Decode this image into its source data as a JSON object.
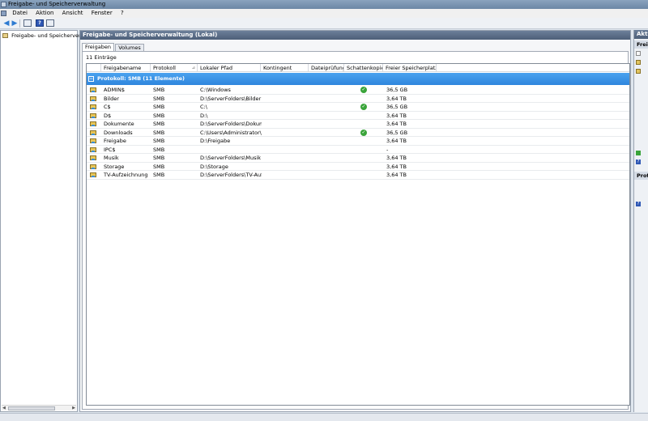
{
  "window": {
    "title": "Freigabe- und Speicherverwaltung"
  },
  "menu": {
    "items": [
      {
        "label": "Datei"
      },
      {
        "label": "Aktion"
      },
      {
        "label": "Ansicht"
      },
      {
        "label": "Fenster"
      },
      {
        "label": "?"
      }
    ]
  },
  "toolbar": {
    "back_icon": "back-arrow-icon",
    "forward_icon": "forward-arrow-icon",
    "help_glyph": "?"
  },
  "tree": {
    "root_label": "Freigabe- und Speicherverwalt"
  },
  "center": {
    "header": "Freigabe- und Speicherverwaltung (Lokal)",
    "tabs": [
      {
        "label": "Freigaben",
        "active": true
      },
      {
        "label": "Volumes",
        "active": false
      }
    ],
    "entry_count": "11 Einträge",
    "columns": [
      {
        "label": "Freigabename"
      },
      {
        "label": "Protokoll"
      },
      {
        "label": "Lokaler Pfad"
      },
      {
        "label": "Kontingent"
      },
      {
        "label": "Dateiprüfung"
      },
      {
        "label": "Schattenkopien"
      },
      {
        "label": "Freier Speicherplatz"
      }
    ],
    "group": {
      "toggle": "⊟",
      "label": "Protokoll: SMB (11 Elemente)"
    },
    "rows": [
      {
        "name": "ADMIN$",
        "protocol": "SMB",
        "path": "C:\\Windows",
        "shadow": true,
        "free": "36,5 GB"
      },
      {
        "name": "Bilder",
        "protocol": "SMB",
        "path": "D:\\ServerFolders\\Bilder",
        "shadow": false,
        "free": "3,64 TB"
      },
      {
        "name": "C$",
        "protocol": "SMB",
        "path": "C:\\",
        "shadow": true,
        "free": "36,5 GB"
      },
      {
        "name": "D$",
        "protocol": "SMB",
        "path": "D:\\",
        "shadow": false,
        "free": "3,64 TB"
      },
      {
        "name": "Dokumente",
        "protocol": "SMB",
        "path": "D:\\ServerFolders\\Dokumente",
        "shadow": false,
        "free": "3,64 TB"
      },
      {
        "name": "Downloads",
        "protocol": "SMB",
        "path": "C:\\Users\\Administrator\\Dow...",
        "shadow": true,
        "free": "36,5 GB"
      },
      {
        "name": "Freigabe",
        "protocol": "SMB",
        "path": "D:\\Freigabe",
        "shadow": false,
        "free": "3,64 TB"
      },
      {
        "name": "IPC$",
        "protocol": "SMB",
        "path": "",
        "shadow": false,
        "free": "-"
      },
      {
        "name": "Musik",
        "protocol": "SMB",
        "path": "D:\\ServerFolders\\Musik",
        "shadow": false,
        "free": "3,64 TB"
      },
      {
        "name": "Storage",
        "protocol": "SMB",
        "path": "D:\\Storage",
        "shadow": false,
        "free": "3,64 TB"
      },
      {
        "name": "TV-Aufzeichnung",
        "protocol": "SMB",
        "path": "D:\\ServerFolders\\TV-Aufzei...",
        "shadow": false,
        "free": "3,64 TB"
      }
    ]
  },
  "actions": {
    "header": "Akti",
    "section1": "Freiga",
    "section2": "Proto",
    "help_glyph": "?"
  },
  "colors": {
    "group_row": "#3a93e6",
    "header_bar": "#5b6d86",
    "check": "#3aa43a"
  }
}
